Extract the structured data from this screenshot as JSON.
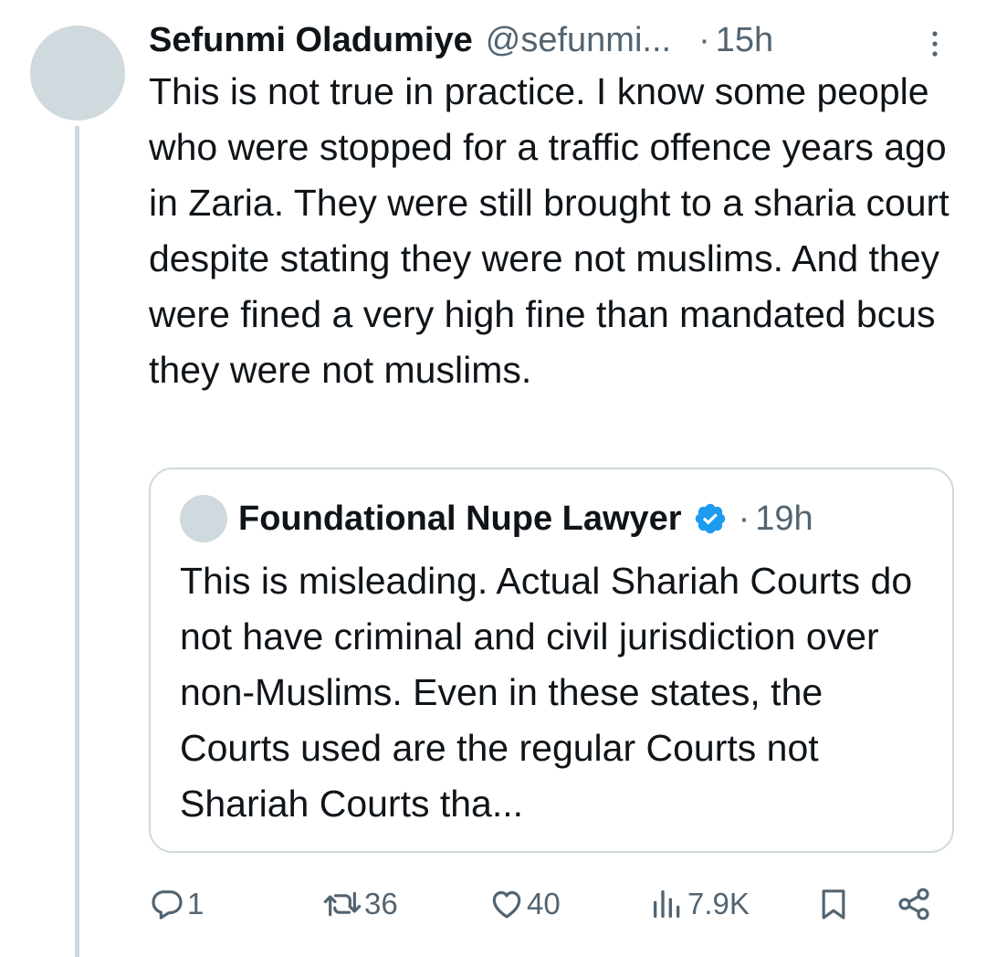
{
  "tweet": {
    "author_name": "Sefunmi Oladumiye",
    "handle": "@sefunmi...",
    "separator": "·",
    "time": "15h",
    "more_icon": "more-vertical-icon",
    "text": "This is not true in practice. I know some people who were stopped for a traffic offence years ago in Zaria. They were still brought to a sharia court despite stating they were not muslims. And they were fined a very high fine than mandated bcus they were not muslims."
  },
  "quote": {
    "author_name": "Foundational Nupe Lawyer",
    "verified": true,
    "verified_icon": "verified-badge-icon",
    "separator": "·",
    "time": "19h",
    "text": "This is misleading. Actual Shariah Courts do not have criminal and civil jurisdiction over non-Muslims. Even in these states, the Courts used are the regular Courts not Shariah Courts tha..."
  },
  "actions": {
    "reply": {
      "icon": "reply-icon",
      "count": "1"
    },
    "retweet": {
      "icon": "retweet-icon",
      "count": "36"
    },
    "like": {
      "icon": "heart-icon",
      "count": "40"
    },
    "views": {
      "icon": "views-icon",
      "count": "7.9K"
    },
    "bookmark": {
      "icon": "bookmark-icon"
    },
    "share": {
      "icon": "share-icon"
    }
  },
  "colors": {
    "text_primary": "#0f1419",
    "text_secondary": "#536471",
    "border": "#cfd9de",
    "avatar_placeholder": "#cfd9de",
    "verified_blue": "#1d9bf0"
  }
}
